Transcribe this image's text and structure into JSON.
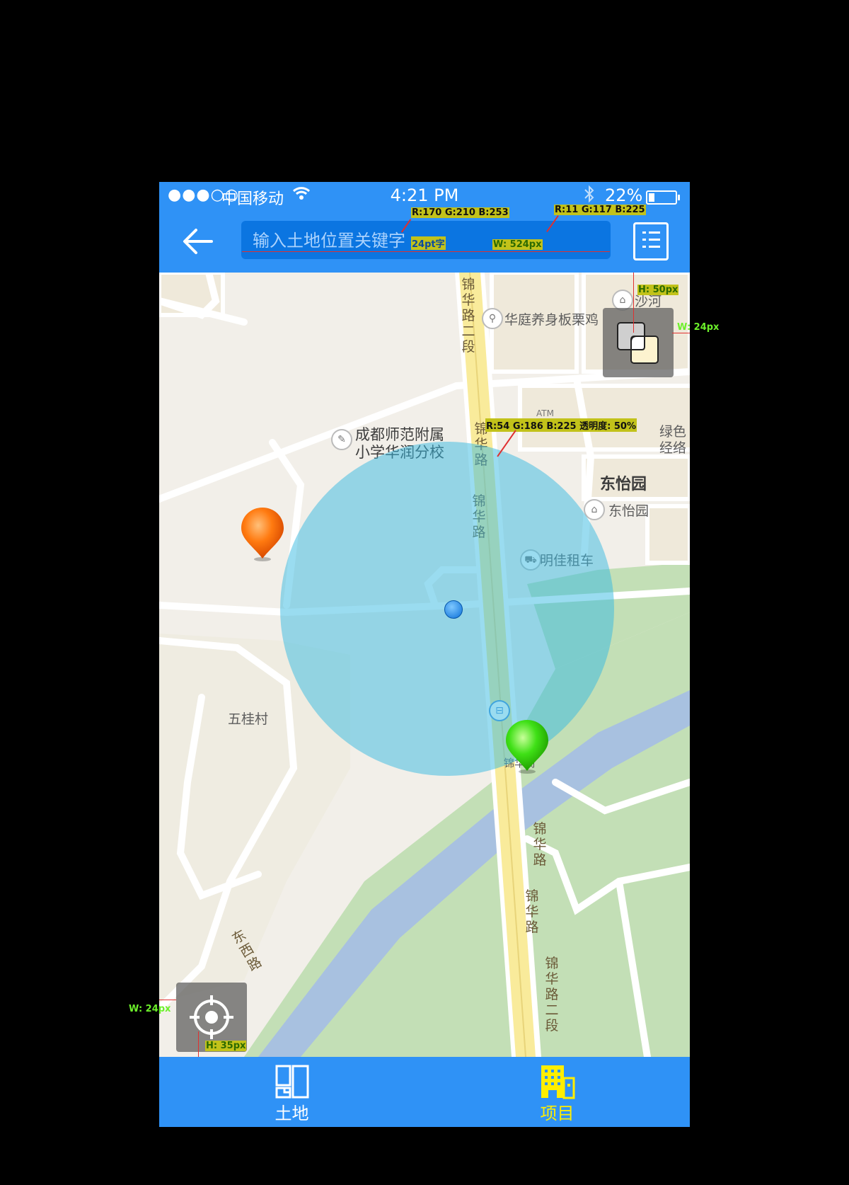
{
  "status": {
    "signal": "●●●○○",
    "carrier": "中国移动",
    "time": "4:21 PM",
    "battery_text": "22%",
    "battery_level": 0.22
  },
  "navbar": {
    "search_placeholder": "输入土地位置关键字"
  },
  "map": {
    "labels": {
      "road_top": "锦华路二段",
      "restaurant": "华庭养身板栗鸡",
      "shahe": "沙河",
      "school_line1": "成都师范附属",
      "school_line2": "小学华润分校",
      "road_mid1": "锦华路",
      "road_mid2": "锦华路",
      "green": "绿色",
      "green2": "经络",
      "dongyiyuan_big": "东怡园",
      "dongyiyuan_poi": "东怡园",
      "car_rental": "明佳租车",
      "village": "五桂村",
      "road_low1": "锦华路",
      "road_low2": "锦华路",
      "road_bottom": "锦华路二段",
      "west_road": "东西路",
      "bus_stop": "锦华街",
      "atm": "ATM"
    },
    "search_radius_opacity": 0.5
  },
  "annotations": {
    "search_color": "R:170  G:210  B:253",
    "search_bg_color": "R:11  G:117  B:225",
    "font_size": "24pt字",
    "search_width": "W:  524px",
    "layer_height": "H:  50px",
    "layer_width": "W:  24px",
    "circle_color": "R:54  G:186  B:225   透明度:  50%",
    "loc_width": "W:  24px",
    "loc_height": "H:  35px"
  },
  "tabs": [
    {
      "label": "土地",
      "active": false
    },
    {
      "label": "项目",
      "active": true
    }
  ],
  "colors": {
    "brand": "#2f92f6",
    "search_bg": "#0b75e1",
    "active_tab": "#ffee00",
    "circle": "#36bae1"
  }
}
